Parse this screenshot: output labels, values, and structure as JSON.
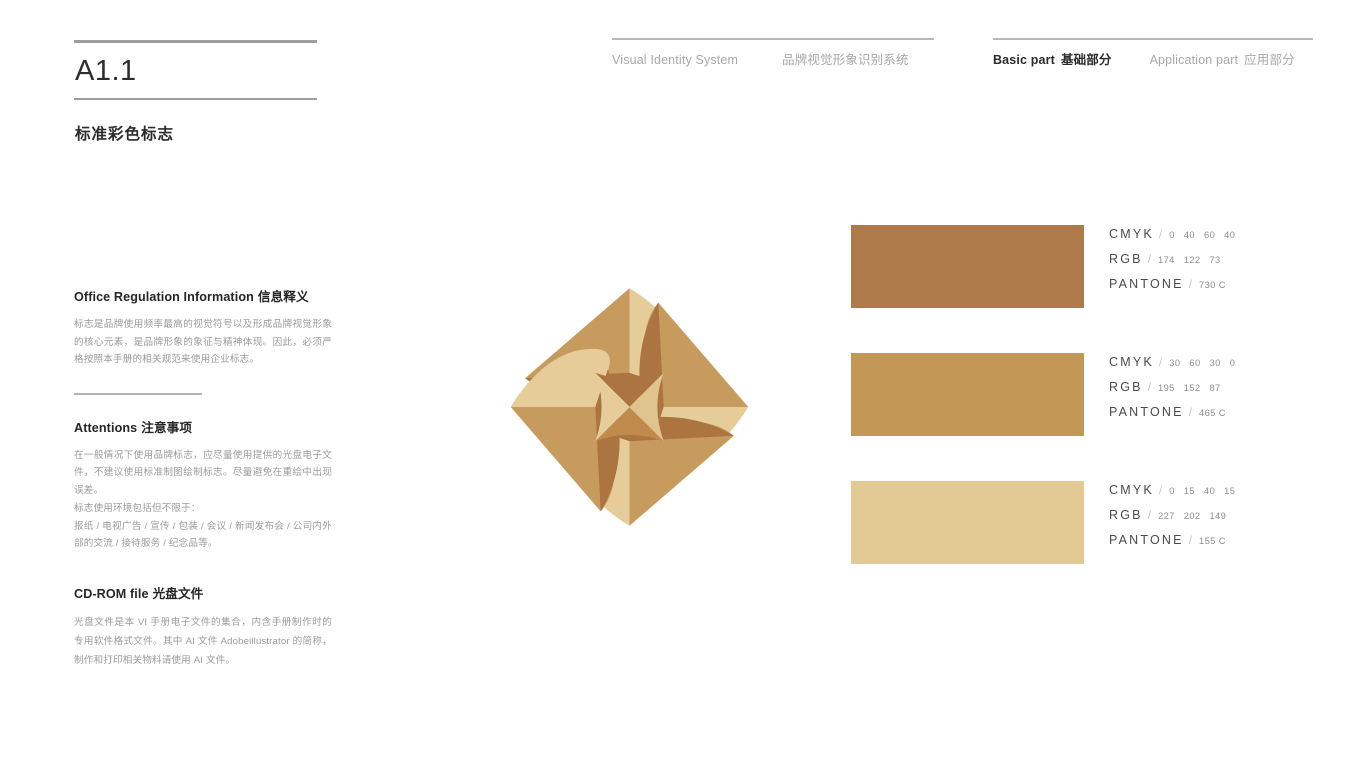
{
  "header": {
    "left_group": {
      "en": "Visual Identity System",
      "cn": "品牌视觉形象识别系统"
    },
    "right_group": {
      "basic_en": "Basic part",
      "basic_cn": "基础部分",
      "application_en": "Application part",
      "application_cn": "应用部分"
    }
  },
  "title": {
    "code": "A1.1",
    "subtitle": "标准彩色标志"
  },
  "sections": [
    {
      "heading_en": "Office Regulation Information",
      "heading_cn": "信息释义",
      "body": "标志是品牌使用频率最高的视觉符号以及形成品牌视觉形象的核心元素，是品牌形象的象征与精神体现。因此，必须严格按照本手册的相关规范来使用企业标志。"
    },
    {
      "heading_en": "Attentions",
      "heading_cn": "注意事项",
      "body1": "在一般情况下使用品牌标志，应尽量使用提供的光盘电子文件，不建议使用标准制图绘制标志。尽量避免在重绘中出现误差。",
      "body2": "标志使用环境包括但不限于：",
      "body3": "报纸 / 电视广告 / 宣传 / 包装 / 会议 / 新闻发布会 / 公司内外部的交流 / 接待服务 / 纪念品等。"
    },
    {
      "heading_en": "CD-ROM file",
      "heading_cn": "光盘文件",
      "body": "光盘文件是本 VI 手册电子文件的集合，内含手册制作时的专用软件格式文件。其中 AI 文件 Adobeillustrator 的简称，制作和打印相关物料请使用 AI 文件。"
    }
  ],
  "swatches": [
    {
      "hex": "#ae7a49",
      "cmyk_label": "CMYK",
      "cmyk": [
        "0",
        "40",
        "60",
        "40"
      ],
      "rgb_label": "RGB",
      "rgb": [
        "174",
        "122",
        "73"
      ],
      "pantone_label": "PANTONE",
      "pantone_number": "730",
      "pantone_suffix": "C"
    },
    {
      "hex": "#c39857",
      "cmyk_label": "CMYK",
      "cmyk": [
        "30",
        "60",
        "30",
        "0"
      ],
      "rgb_label": "RGB",
      "rgb": [
        "195",
        "152",
        "87"
      ],
      "pantone_label": "PANTONE",
      "pantone_number": "465",
      "pantone_suffix": "C"
    },
    {
      "hex": "#e3ca95",
      "cmyk_label": "CMYK",
      "cmyk": [
        "0",
        "15",
        "40",
        "15"
      ],
      "rgb_label": "RGB",
      "rgb": [
        "227",
        "202",
        "149"
      ],
      "pantone_label": "PANTONE",
      "pantone_number": "155",
      "pantone_suffix": "C"
    }
  ],
  "logo": {
    "name": "brand-logo-mark",
    "colors": {
      "dark": "#ab7440",
      "mid": "#c79a5d",
      "light": "#e5cc98",
      "mid2": "#d4ae72"
    }
  }
}
